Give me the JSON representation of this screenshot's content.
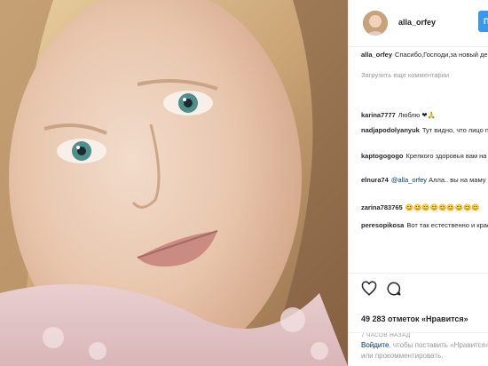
{
  "post": {
    "username": "alla_orfey",
    "follow_label": "Подписаться",
    "caption_text": "Спасибо,Господи,за новый день в моей жизни и день.Пусть не коснётся злоба людская",
    "load_more": "Загрузить еще комментарии",
    "comments": [
      {
        "user": "karina7777",
        "text": "Люблю ❤🙏"
      },
      {
        "user": "nadjapodolyanyuk",
        "text": "Тут видно, что лицо полностью мамина доча, похожа"
      },
      {
        "user": "kaptogogogo",
        "text": "Крепкого здоровья вам на долгие лет!"
      },
      {
        "user": "elnura74",
        "mention": "@alla_orfey",
        "text": "Алла.. вы на маму похожи. Спасибо вам за это"
      },
      {
        "user": "zarina783765",
        "text": "😊😊😊😊😊😊😊😊😊"
      },
      {
        "user": "peresopikosa",
        "text": "Вот так естественно и красиво Алла!Ну зачем этот макияж прекрасно и без него,то крайне нужна кожа дышит Оставайтесь такой как есть весь"
      }
    ],
    "likes_text": "49 283 отметок «Нравится»",
    "time_text": "7 ЧАСОВ НАЗАД",
    "login_link": "Войдите",
    "login_rest_line1": ", чтобы поставить «Нравится»",
    "login_rest_line2": "или прокомментировать.",
    "icons": {
      "like": "heart-icon",
      "comment": "comment-icon"
    },
    "colors": {
      "accent": "#3897f0",
      "link": "#003569",
      "muted": "#999999",
      "text": "#262626"
    }
  }
}
